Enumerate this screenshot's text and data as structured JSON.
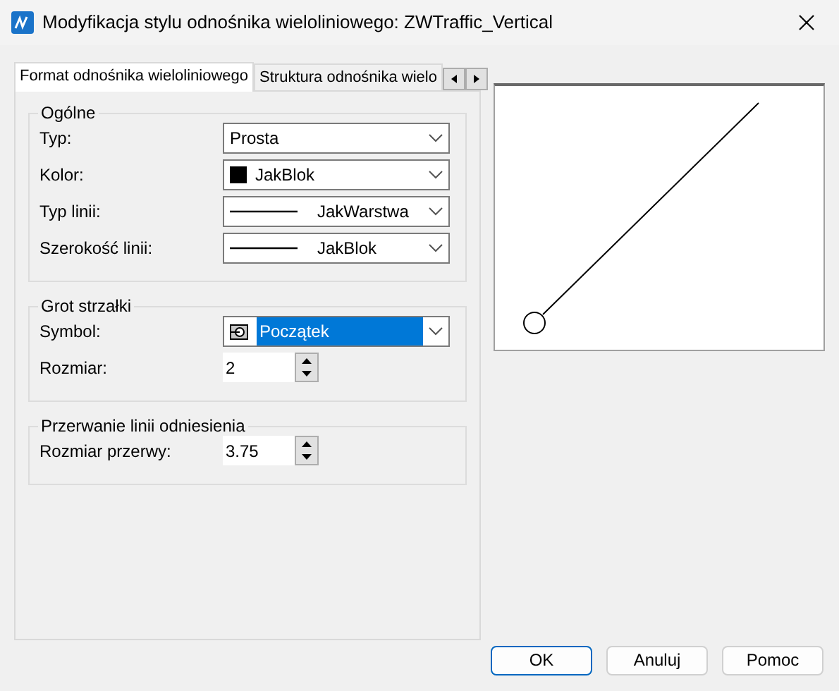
{
  "window": {
    "title": "Modyfikacja stylu odnośnika wieloliniowego: ZWTraffic_Vertical"
  },
  "tabs": [
    {
      "label": "Format odnośnika wieloliniowego",
      "selected": true
    },
    {
      "label": "Struktura odnośnika wielo",
      "selected": false
    }
  ],
  "groups": [
    {
      "title": "Ogólne",
      "fields": [
        {
          "label": "Typ:",
          "kind": "combo",
          "value": "Prosta",
          "highlighted": false
        },
        {
          "label": "Kolor:",
          "kind": "color-combo",
          "value": "JakBlok",
          "highlighted": false
        },
        {
          "label": "Typ linii:",
          "kind": "line-combo",
          "value": "JakWarstwa",
          "highlighted": false
        },
        {
          "label": "Szerokość linii:",
          "kind": "line-combo",
          "value": "JakBlok",
          "highlighted": false
        }
      ]
    },
    {
      "title": "Grot strzałki",
      "fields": [
        {
          "label": "Symbol:",
          "kind": "symbol-combo",
          "value": "Początek",
          "highlighted": true
        },
        {
          "label": "Rozmiar:",
          "kind": "spin",
          "value": "2"
        }
      ]
    },
    {
      "title": "Przerwanie linii odniesienia",
      "fields": [
        {
          "label": "Rozmiar przerwy:",
          "kind": "spin",
          "value": "3.75"
        }
      ]
    }
  ],
  "buttons": [
    {
      "label": "OK",
      "default": true
    },
    {
      "label": "Anuluj",
      "default": false
    },
    {
      "label": "Pomoc",
      "default": false
    }
  ]
}
